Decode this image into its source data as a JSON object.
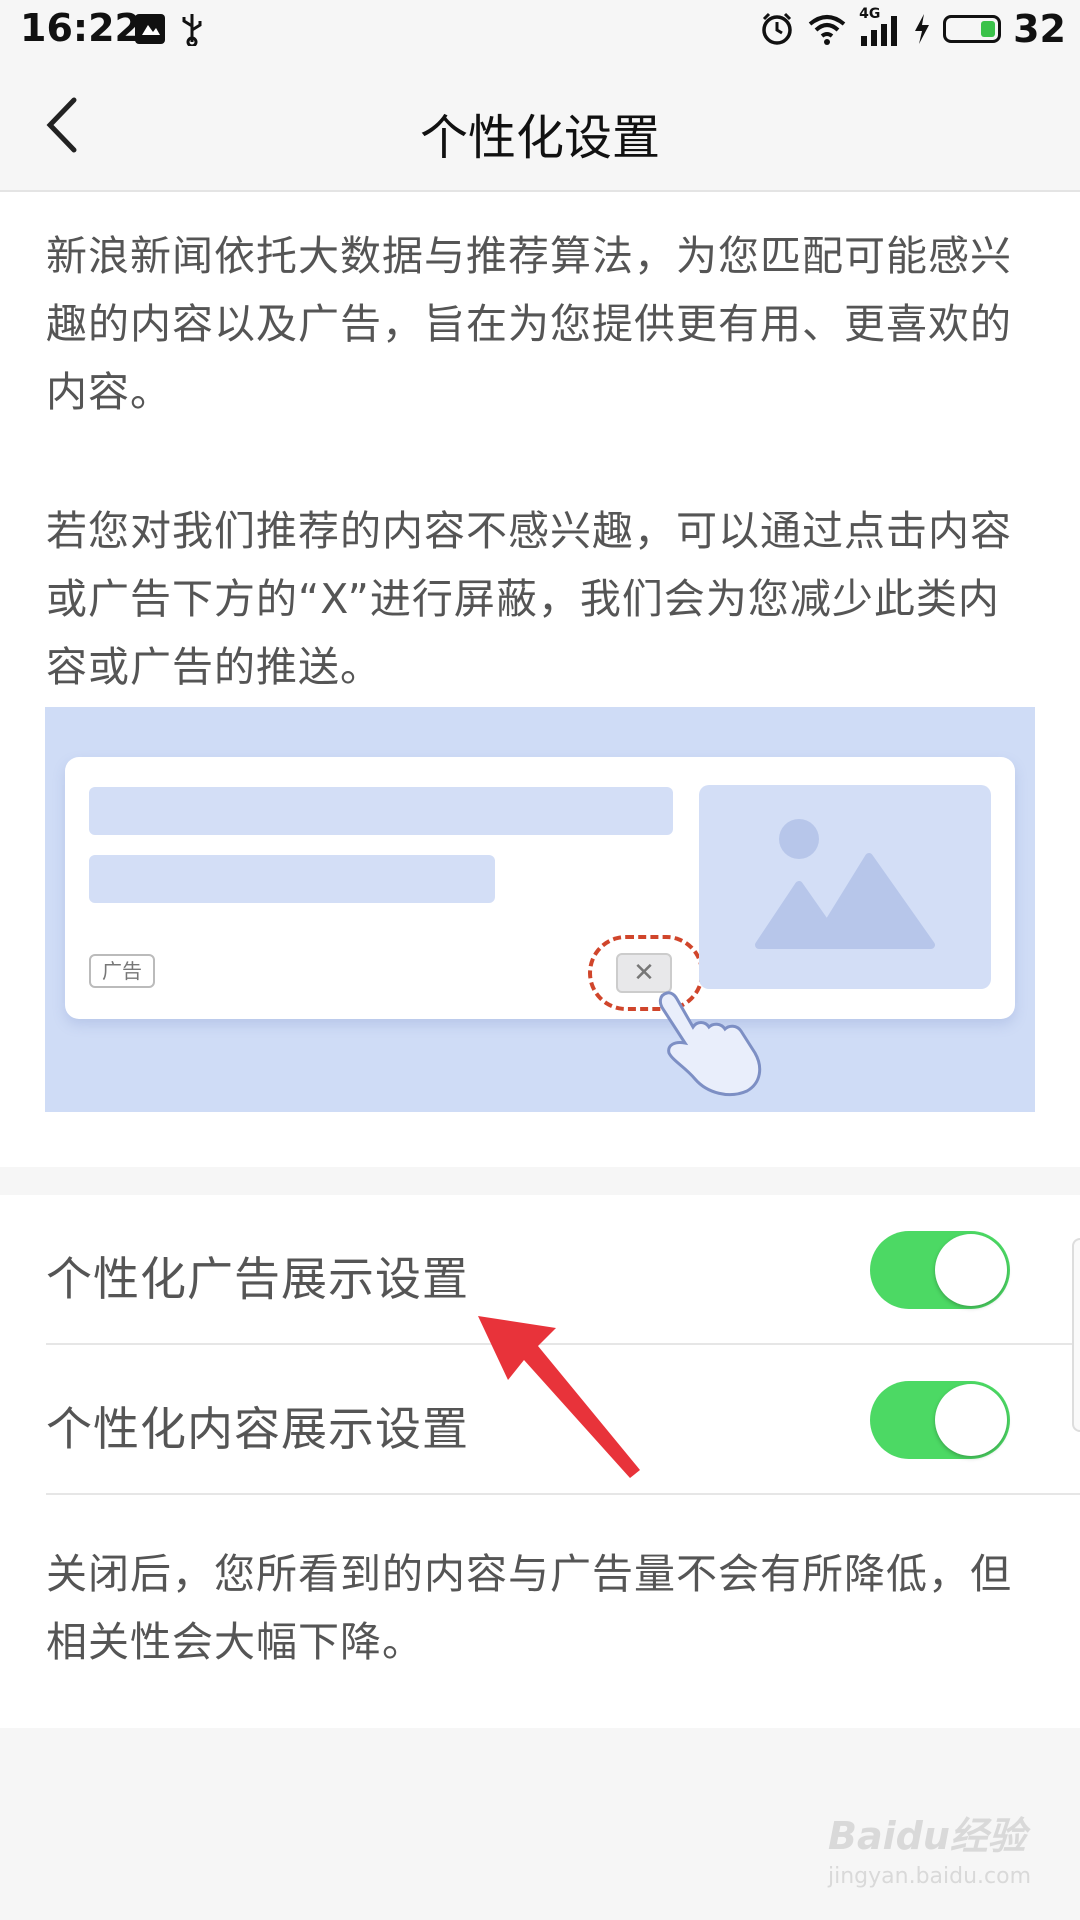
{
  "status_bar": {
    "time": "16:22",
    "left_icons": [
      "gallery-icon",
      "usb-icon"
    ],
    "right_icons": [
      "alarm-icon",
      "wifi-icon",
      "signal-4g-icon",
      "charging-icon",
      "battery-icon"
    ],
    "network_label": "4G",
    "battery": "32"
  },
  "header": {
    "title": "个性化设置"
  },
  "intro": {
    "paragraph1": "新浪新闻依托大数据与推荐算法，为您匹配可能感兴趣的内容以及广告，旨在为您提供更有用、更喜欢的内容。",
    "paragraph2": "若您对我们推荐的内容不感兴趣，可以通过点击内容或广告下方的“X”进行屏蔽，我们会为您减少此类内容或广告的推送。",
    "illustration": {
      "ad_tag": "广告",
      "close_glyph": "✕"
    }
  },
  "settings": {
    "ad_toggle_label": "个性化广告展示设置",
    "ad_toggle_on": true,
    "content_toggle_label": "个性化内容展示设置",
    "content_toggle_on": true,
    "footnote": "关闭后，您所看到的内容与广告量不会有所降低，但相关性会大幅下降。"
  },
  "watermark": {
    "main": "Baidu经验",
    "sub": "jingyan.baidu.com"
  },
  "colors": {
    "toggle_on": "#4cd964",
    "illustration_bg": "#cfdcf6",
    "arrow": "#e8333a",
    "dashed_circle": "#d0452b"
  }
}
